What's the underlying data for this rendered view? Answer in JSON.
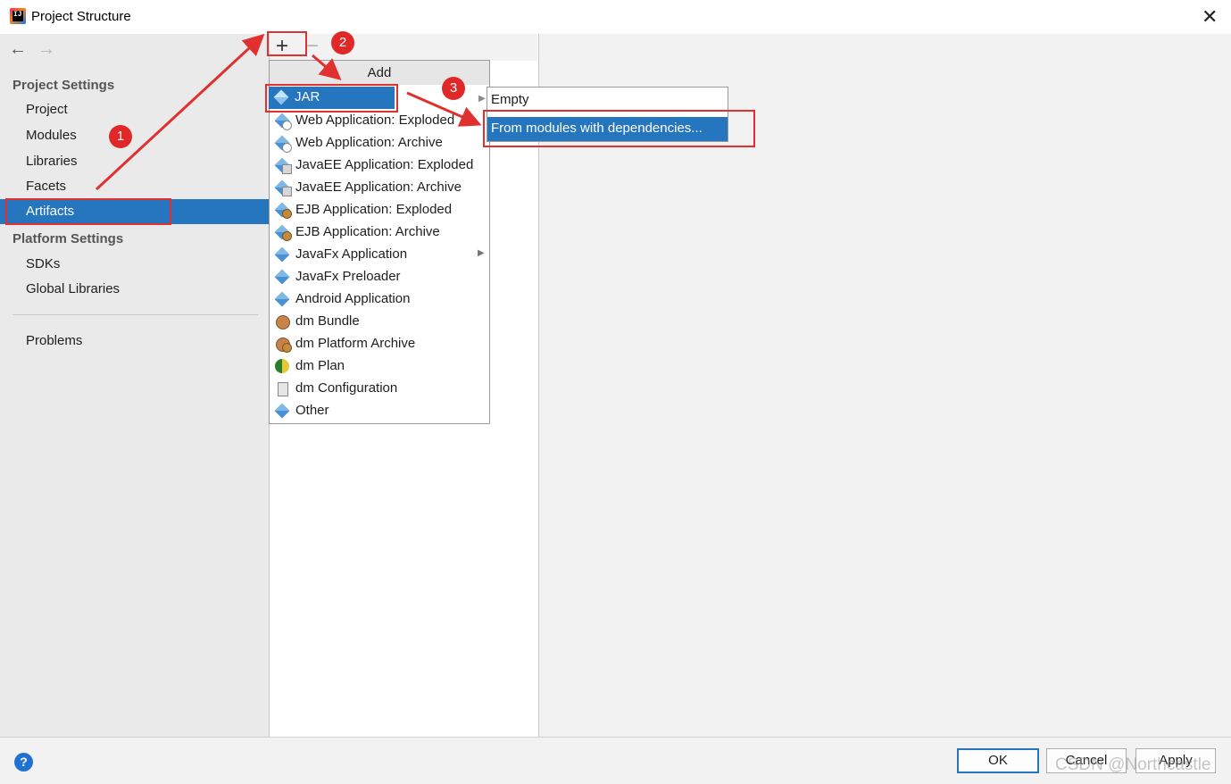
{
  "window": {
    "title": "Project Structure"
  },
  "sidebar": {
    "project_settings_header": "Project Settings",
    "project_items": [
      {
        "label": "Project"
      },
      {
        "label": "Modules"
      },
      {
        "label": "Libraries"
      },
      {
        "label": "Facets"
      },
      {
        "label": "Artifacts"
      }
    ],
    "platform_settings_header": "Platform Settings",
    "platform_items": [
      {
        "label": "SDKs"
      },
      {
        "label": "Global Libraries"
      }
    ],
    "problems": "Problems"
  },
  "toolbar": {
    "add_glyph": "+",
    "remove_glyph": "−"
  },
  "add_menu": {
    "title": "Add",
    "items": [
      {
        "label": "JAR",
        "icon": "jar-icon"
      },
      {
        "label": "Web Application: Exploded",
        "icon": "web-app-icon"
      },
      {
        "label": "Web Application: Archive",
        "icon": "web-app-icon"
      },
      {
        "label": "JavaEE Application: Exploded",
        "icon": "javaee-icon"
      },
      {
        "label": "JavaEE Application: Archive",
        "icon": "javaee-icon"
      },
      {
        "label": "EJB Application: Exploded",
        "icon": "ejb-icon"
      },
      {
        "label": "EJB Application: Archive",
        "icon": "ejb-icon"
      },
      {
        "label": "JavaFx Application",
        "icon": "javafx-icon"
      },
      {
        "label": "JavaFx Preloader",
        "icon": "javafx-icon"
      },
      {
        "label": "Android Application",
        "icon": "android-icon"
      },
      {
        "label": "dm Bundle",
        "icon": "dm-bundle-icon"
      },
      {
        "label": "dm Platform Archive",
        "icon": "dm-bundle-icon"
      },
      {
        "label": "dm Plan",
        "icon": "dm-plan-icon"
      },
      {
        "label": "dm Configuration",
        "icon": "dm-config-icon"
      },
      {
        "label": "Other",
        "icon": "other-icon"
      }
    ]
  },
  "jar_submenu": {
    "items": [
      {
        "label": "Empty"
      },
      {
        "label": "From modules with dependencies..."
      }
    ]
  },
  "annotations": {
    "step1": "1",
    "step2": "2",
    "step3": "3"
  },
  "footer": {
    "help": "?",
    "ok": "OK",
    "cancel": "Cancel",
    "apply": "Apply",
    "watermark": "CSDN @Northcastle"
  },
  "colors": {
    "selection": "#2675bf",
    "annotation": "#e03030"
  }
}
